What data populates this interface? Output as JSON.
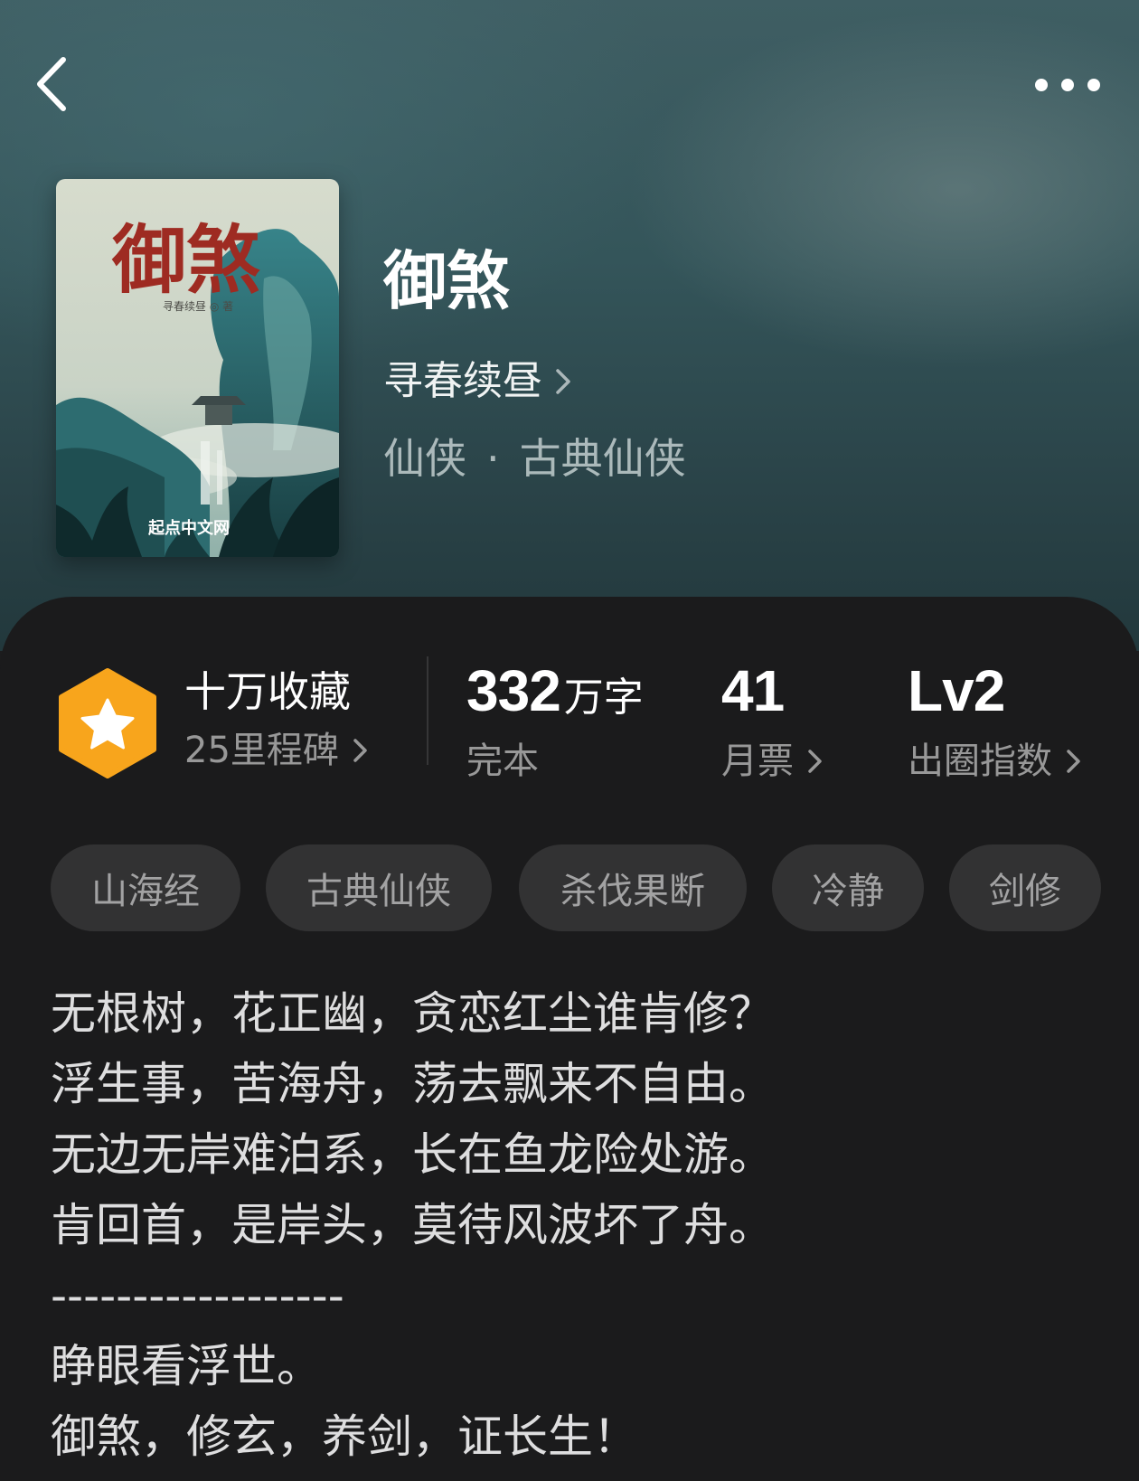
{
  "header": {
    "back_icon": "chevron-left-icon",
    "more_icon": "more-horizontal-icon"
  },
  "book": {
    "title": "御煞",
    "author": "寻春续昼",
    "category": "仙侠",
    "subcategory": "古典仙侠",
    "separator": "·",
    "cover": {
      "title": "御煞",
      "author_line": "寻春续昼 ◎ 著",
      "publisher": "起点中文网"
    }
  },
  "stats": {
    "milestone": {
      "title": "十万收藏",
      "sub": "25里程碑"
    },
    "words": {
      "value": "332",
      "unit": "万字",
      "status": "完本"
    },
    "monthly_votes": {
      "value": "41",
      "label": "月票"
    },
    "popularity": {
      "value": "Lv2",
      "label": "出圈指数"
    }
  },
  "tags": [
    "山海经",
    "古典仙侠",
    "杀伐果断",
    "冷静",
    "剑修"
  ],
  "intro": [
    "无根树，花正幽，贪恋红尘谁肯修？",
    "浮生事，苦海舟，荡去飘来不自由。",
    "无边无岸难泊系，长在鱼龙险处游。",
    "肯回首，是岸头，莫待风波坏了舟。",
    "------------------",
    "睁眼看浮世。",
    "御煞，修玄，养剑，证长生！"
  ],
  "colors": {
    "hero_top": "#3f5e63",
    "hero_bottom": "#22383c",
    "panel_bg": "#1b1b1c",
    "tag_bg": "#323233",
    "badge_orange": "#f8a51c",
    "cover_title_red": "#9e2b22"
  }
}
